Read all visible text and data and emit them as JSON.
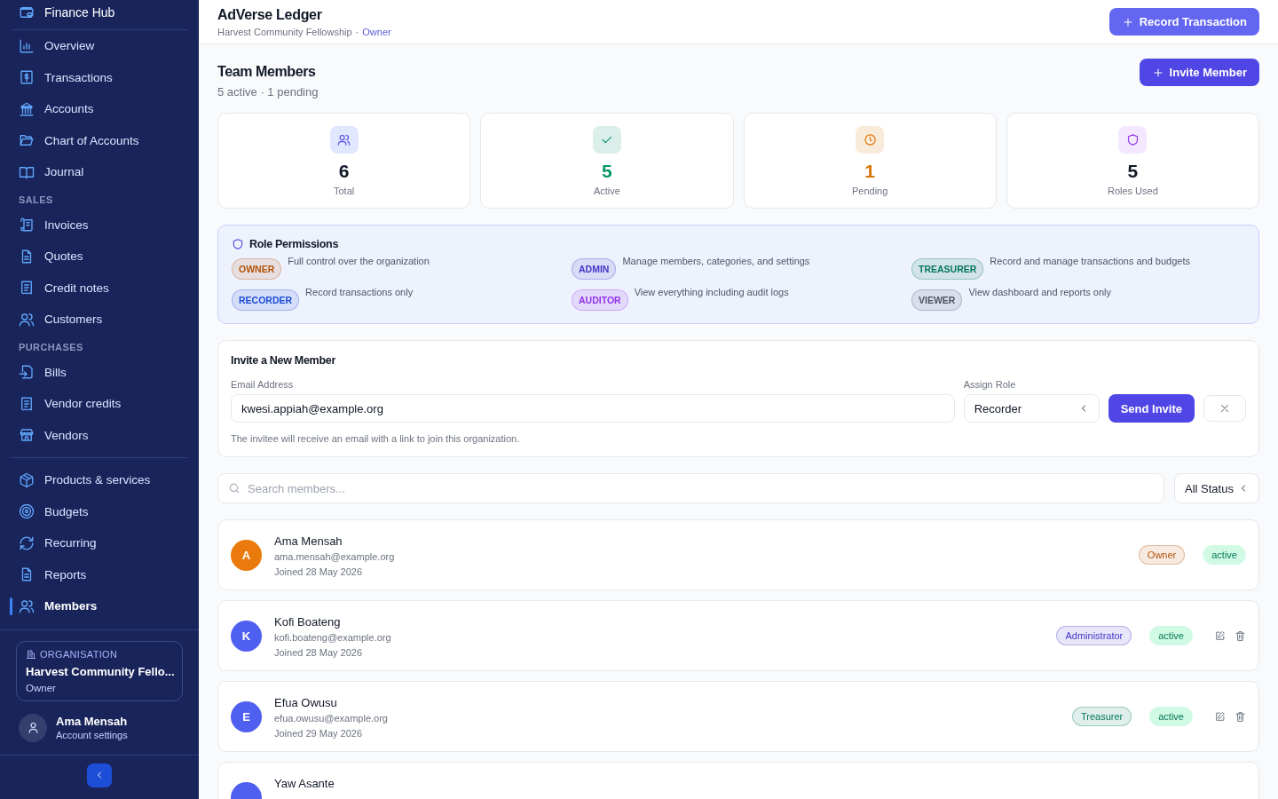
{
  "sidebar": {
    "brand": "Finance Hub",
    "groups": [
      {
        "items": [
          {
            "label": "Overview",
            "kind": "chart",
            "selected": false
          },
          {
            "label": "Transactions",
            "kind": "dollar",
            "selected": false
          },
          {
            "label": "Accounts",
            "kind": "bank",
            "selected": false
          },
          {
            "label": "Chart of Accounts",
            "kind": "folder",
            "selected": false
          },
          {
            "label": "Journal",
            "kind": "book",
            "selected": false
          }
        ]
      },
      {
        "heading": "SALES",
        "items": [
          {
            "label": "Invoices",
            "kind": "scroll",
            "selected": false
          },
          {
            "label": "Quotes",
            "kind": "doc",
            "selected": false
          },
          {
            "label": "Credit notes",
            "kind": "receipt",
            "selected": false
          },
          {
            "label": "Customers",
            "kind": "users",
            "selected": false
          }
        ]
      },
      {
        "heading": "PURCHASES",
        "items": [
          {
            "label": "Bills",
            "kind": "import",
            "selected": false
          },
          {
            "label": "Vendor credits",
            "kind": "receipt",
            "selected": false
          },
          {
            "label": "Vendors",
            "kind": "store",
            "selected": false
          }
        ]
      },
      {
        "items": [
          {
            "label": "Products & services",
            "kind": "box",
            "selected": false
          },
          {
            "label": "Budgets",
            "kind": "target",
            "selected": false
          },
          {
            "label": "Recurring",
            "kind": "refresh",
            "selected": false
          },
          {
            "label": "Reports",
            "kind": "doc",
            "selected": false
          },
          {
            "label": "Members",
            "kind": "users",
            "selected": true
          }
        ]
      }
    ],
    "org": {
      "label": "ORGANISATION",
      "name": "Harvest Community Fello...",
      "role": "Owner"
    },
    "user": {
      "name": "Ama Mensah",
      "link": "Account settings"
    }
  },
  "header": {
    "title": "AdVerse Ledger",
    "org": "Harvest Community Fellowship",
    "separator": "·",
    "role": "Owner",
    "button": "Record Transaction"
  },
  "page": {
    "title": "Team Members",
    "subtitle": "5 active · 1 pending",
    "button": "Invite Member"
  },
  "stats": [
    {
      "value": "6",
      "label": "Total",
      "kind": "users",
      "color": "#111827"
    },
    {
      "value": "5",
      "label": "Active",
      "kind": "check",
      "color": "#059669"
    },
    {
      "value": "1",
      "label": "Pending",
      "kind": "clock",
      "color": "#d97706"
    },
    {
      "value": "5",
      "label": "Roles Used",
      "kind": "shield",
      "color": "#111827"
    }
  ],
  "permissions": {
    "title": "Role Permissions",
    "roles": [
      {
        "role": "OWNER",
        "description": "Full control over the organization",
        "color": "#b45309"
      },
      {
        "role": "ADMIN",
        "description": "Manage members, categories, and settings",
        "color": "#4338ca"
      },
      {
        "role": "TREASURER",
        "description": "Record and manage transactions and budgets",
        "color": "#047857"
      },
      {
        "role": "RECORDER",
        "description": "Record transactions only",
        "color": "#1d4ed8"
      },
      {
        "role": "AUDITOR",
        "description": "View everything including audit logs",
        "color": "#9333ea"
      },
      {
        "role": "VIEWER",
        "description": "View dashboard and reports only",
        "color": "#4b5563"
      }
    ]
  },
  "invite": {
    "title": "Invite a New Member",
    "email_label": "Email Address",
    "email": "kwesi.appiah@example.org",
    "role_label": "Assign Role",
    "role": "Recorder",
    "button": "Send Invite",
    "hint": "The invitee will receive an email with a link to join this organization."
  },
  "filters": {
    "search_placeholder": "Search members...",
    "status": "All Status"
  },
  "members": [
    {
      "avatar": {
        "initial": "A",
        "color": "#ea7a0c"
      },
      "name": "Ama Mensah",
      "email": "ama.mensah@example.org",
      "joined": "Joined 28 May 2026",
      "role": "Owner",
      "status": "active",
      "color": "#b45309",
      "actions": false
    },
    {
      "avatar": {
        "initial": "K",
        "color": "#4f5ff0"
      },
      "name": "Kofi Boateng",
      "email": "kofi.boateng@example.org",
      "joined": "Joined 28 May 2026",
      "role": "Administrator",
      "status": "active",
      "color": "#4338ca",
      "actions": true
    },
    {
      "avatar": {
        "initial": "E",
        "color": "#4f5ff0"
      },
      "name": "Efua Owusu",
      "email": "efua.owusu@example.org",
      "joined": "Joined 29 May 2026",
      "role": "Treasurer",
      "status": "active",
      "color": "#047857",
      "actions": true
    },
    {
      "avatar": {
        "color": "#4f5ff0"
      },
      "name": "Yaw Asante"
    }
  ]
}
